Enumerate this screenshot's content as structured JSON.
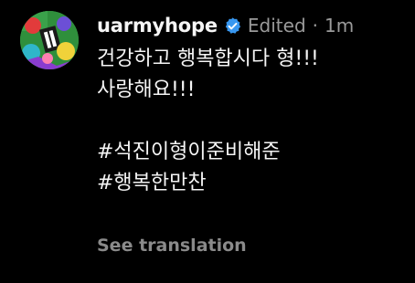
{
  "comment": {
    "username": "uarmyhope",
    "status": "Edited",
    "separator": "·",
    "time": "1m",
    "lines": [
      "건강하고 행복합시다 형!!!",
      "사랑해요!!!"
    ],
    "hashtags": [
      "#석진이형이준비해준",
      "#행복한만찬"
    ],
    "translate_label": "See translation"
  },
  "icons": {
    "avatar": "profile-avatar",
    "verified": "verified-badge-icon"
  },
  "colors": {
    "background": "#000000",
    "text": "#f5f5f5",
    "muted": "#9a9a9a",
    "verified": "#3897f0"
  }
}
